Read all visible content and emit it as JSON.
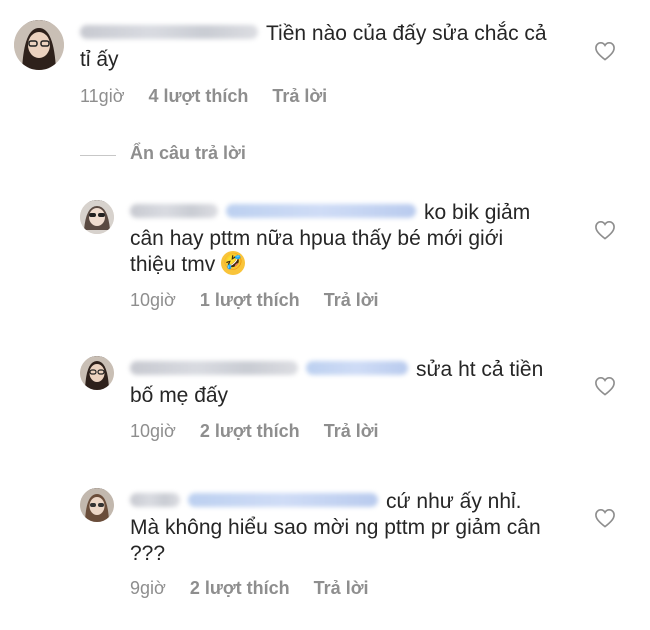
{
  "comments": [
    {
      "text": "Tiền nào của đấy sửa chắc cả tỉ ấy",
      "time": "11giờ",
      "likes": "4 lượt thích",
      "reply": "Trả lời"
    },
    {
      "text": "ko bik giảm cân hay pttm nữa hpua thấy bé mới giới thiệu tmv",
      "emoji": "🤣",
      "time": "10giờ",
      "likes": "1 lượt thích",
      "reply": "Trả lời"
    },
    {
      "text": "sửa ht cả tiền bố mẹ đấy",
      "time": "10giờ",
      "likes": "2 lượt thích",
      "reply": "Trả lời"
    },
    {
      "text": "cứ như ấy nhỉ. Mà không hiểu sao mời ng pttm pr giảm cân ???",
      "time": "9giờ",
      "likes": "2 lượt thích",
      "reply": "Trả lời"
    }
  ],
  "hide_replies": "Ẩn câu trả lời",
  "icons": {
    "like": "heart-icon",
    "avatar": "avatar"
  },
  "colors": {
    "text": "#262626",
    "meta": "#8e8e8e",
    "divider": "#c7c7c7"
  }
}
